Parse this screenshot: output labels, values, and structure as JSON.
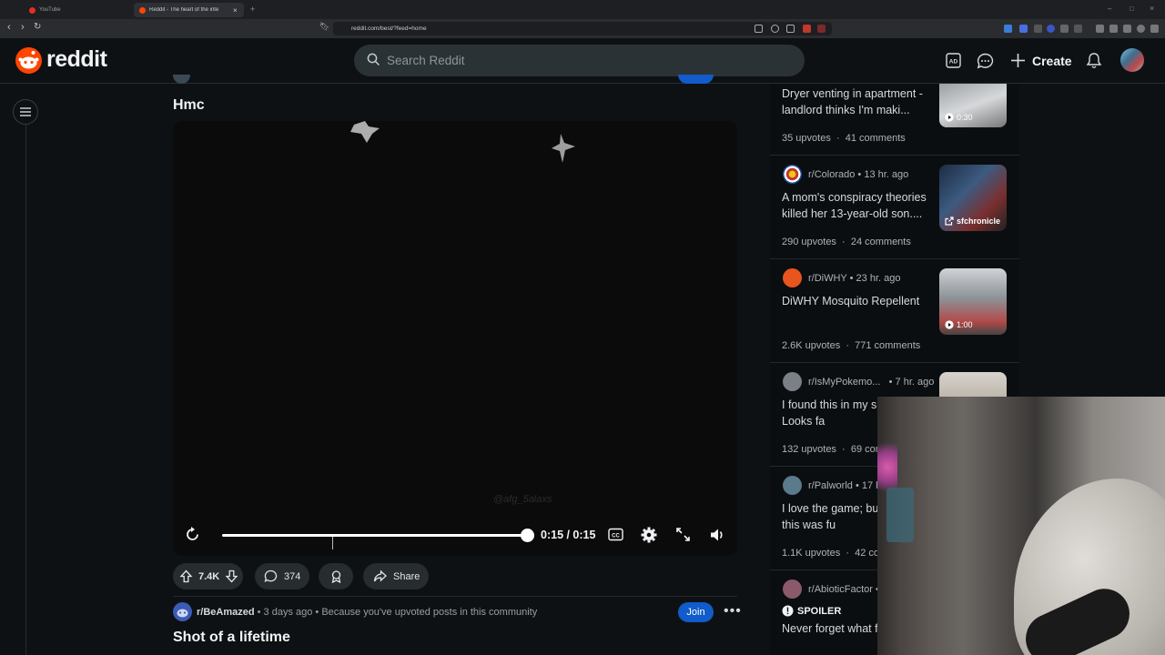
{
  "browser": {
    "tabs": [
      {
        "title": "YouTube",
        "active": false
      },
      {
        "title": "Reddit - The heart of the inte",
        "active": true
      }
    ],
    "url": "reddit.com/best/?feed=home"
  },
  "header": {
    "logo_text": "reddit",
    "search_placeholder": "Search Reddit",
    "create_label": "Create"
  },
  "post": {
    "title": "Hmc",
    "time": "0:15 / 0:15",
    "watermark": "@afg_5alaxs",
    "votes": "7.4K",
    "comments": "374",
    "share_label": "Share"
  },
  "next_post": {
    "subreddit": "r/BeAmazed",
    "meta": "• 3 days ago • Because you've upvoted posts in this community",
    "join_label": "Join",
    "title": "Shot of a lifetime"
  },
  "sidebar": {
    "items": [
      {
        "subreddit": "",
        "time": "",
        "title": "Dryer venting in apartment - landlord thinks I'm maki...",
        "upvotes": "35 upvotes",
        "comments": "41 comments",
        "badge": "0:30"
      },
      {
        "subreddit": "r/Colorado",
        "time": "• 13 hr. ago",
        "title": "A mom's conspiracy theories killed her 13-year-old son....",
        "upvotes": "290 upvotes",
        "comments": "24 comments",
        "badge": "sfchronicle"
      },
      {
        "subreddit": "r/DiWHY",
        "time": "• 23 hr. ago",
        "title": "DiWHY Mosquito Repellent",
        "upvotes": "2.6K upvotes",
        "comments": "771 comments",
        "badge": "1:00"
      },
      {
        "subreddit": "r/IsMyPokemo...",
        "time": "• 7 hr. ago",
        "title": "I found this in my s collection. Looks fa",
        "upvotes": "132 upvotes",
        "comments": "69 com",
        "badge": ""
      },
      {
        "subreddit": "r/Palworld",
        "time": "• 17 h",
        "title": "I love the game; bu thought this was fu",
        "upvotes": "1.1K upvotes",
        "comments": "42 co",
        "badge": ""
      },
      {
        "subreddit": "r/AbioticFactor",
        "time": "•",
        "spoiler": "SPOILER",
        "title": "Never forget what from us",
        "upvotes": "",
        "comments": "",
        "badge": ""
      }
    ]
  },
  "colors": {
    "brand": "#ff4500",
    "join": "#115bca",
    "background": "#0e1113"
  }
}
